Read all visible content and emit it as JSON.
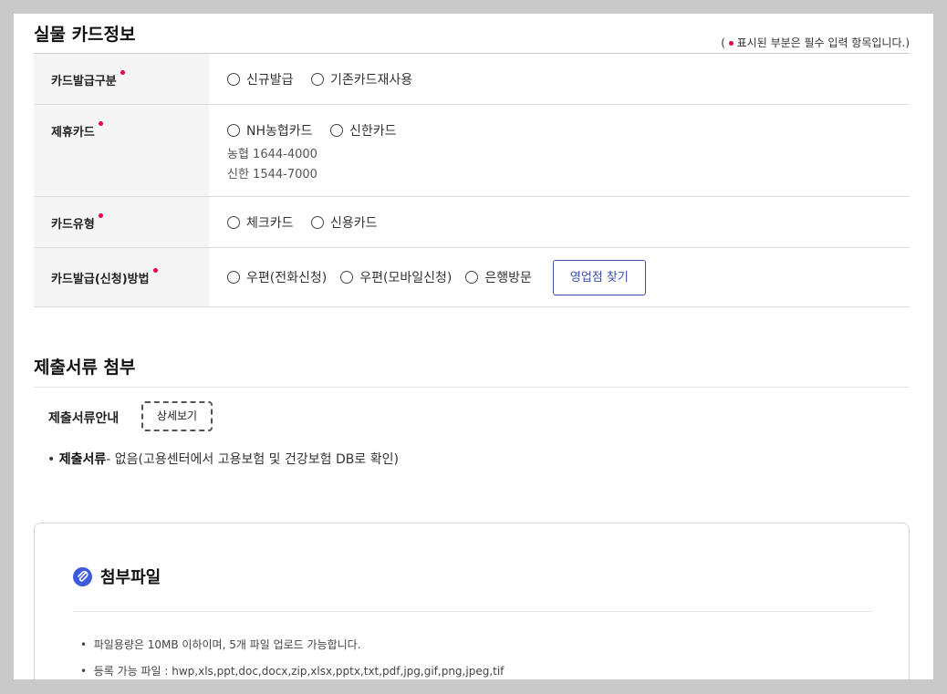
{
  "card_info": {
    "title": "실물 카드정보",
    "required_note": "( ● 표시된 부분은 필수 입력 항목입니다.)",
    "required_note_open": "(",
    "required_note_text": "표시된 부분은 필수 입력 항목입니다.)",
    "rows": [
      {
        "label": "카드발급구분",
        "options": [
          "신규발급",
          "기존카드재사용"
        ]
      },
      {
        "label": "제휴카드",
        "options": [
          "NH농협카드",
          "신한카드"
        ],
        "phones": [
          "농협 1644-4000",
          "신한 1544-7000"
        ]
      },
      {
        "label": "카드유형",
        "options": [
          "체크카드",
          "신용카드"
        ]
      },
      {
        "label": "카드발급(신청)방법",
        "options": [
          "우편(전화신청)",
          "우편(모바일신청)",
          "은행방문"
        ],
        "button": "영업점 찾기"
      }
    ]
  },
  "documents": {
    "title": "제출서류 첨부",
    "guide_label": "제출서류안내",
    "detail_button": "상세보기",
    "doc_label": "제출서류",
    "doc_text": "- 없음(고용센터에서 고용보험 및 건강보험 DB로 확인)"
  },
  "attachments": {
    "title": "첨부파일",
    "notes": [
      "파일용량은 10MB 이하이며, 5개 파일 업로드 가능합니다.",
      "등록 가능 파일 : hwp,xls,ppt,doc,docx,zip,xlsx,pptx,txt,pdf,jpg,gif,png,jpeg,tif"
    ]
  },
  "colors": {
    "required_dot": "#e0004d",
    "accent": "#3a4fa8",
    "clip_icon": "#3d5bd9"
  },
  "icons": [
    "required-dot",
    "radio-circle",
    "paperclip-icon"
  ]
}
